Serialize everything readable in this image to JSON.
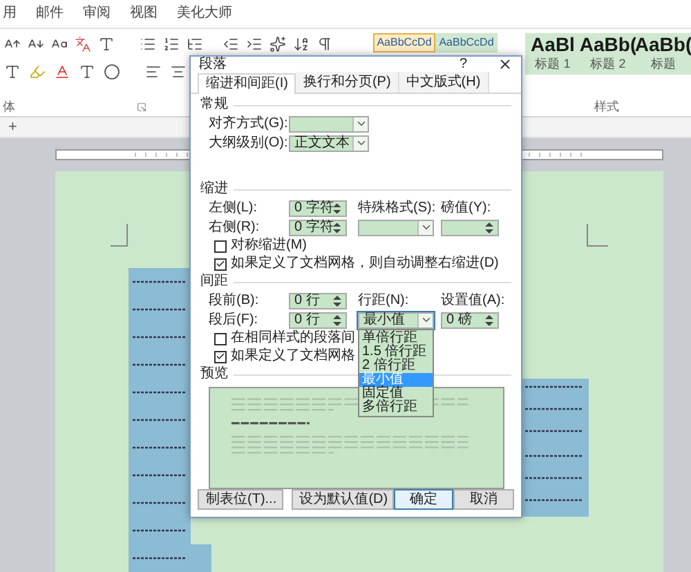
{
  "ribbon": {
    "tabs": [
      {
        "label": "用",
        "selected": false
      },
      {
        "label": "邮件",
        "selected": false
      },
      {
        "label": "审阅",
        "selected": false
      },
      {
        "label": "视图",
        "selected": false
      },
      {
        "label": "美化大师",
        "selected": false
      }
    ],
    "font_group_label": "体",
    "styles_group_label": "样式",
    "styles": [
      {
        "preview": "AaBbCcDd",
        "selected": true,
        "kind": "body"
      },
      {
        "preview": "AaBbCcDd",
        "selected": false,
        "kind": "body"
      },
      {
        "preview": "AaBl",
        "name": "标题 1",
        "selected": false,
        "kind": "heading"
      },
      {
        "preview": "AaBb(",
        "name": "标题 2",
        "selected": false,
        "kind": "heading"
      },
      {
        "preview": "AaBb(",
        "name": "标题",
        "selected": false,
        "kind": "heading"
      }
    ]
  },
  "document_tabs": {
    "add_label": "+"
  },
  "dialog": {
    "title": "段落",
    "help": "?",
    "tabs": [
      {
        "label": "缩进和间距(I)",
        "selected": true
      },
      {
        "label": "换行和分页(P)",
        "selected": false
      },
      {
        "label": "中文版式(H)",
        "selected": false
      }
    ],
    "general": {
      "heading": "常规",
      "alignment": {
        "label": "对齐方式(G):"
      },
      "outline_level": {
        "label": "大纲级别(O):",
        "value": "正文文本"
      }
    },
    "indent": {
      "heading": "缩进",
      "left": {
        "label": "左侧(L):",
        "value": "0 字符"
      },
      "right": {
        "label": "右侧(R):",
        "value": "0 字符"
      },
      "special": {
        "label": "特殊格式(S):"
      },
      "by": {
        "label": "磅值(Y):"
      },
      "checkboxes": [
        {
          "label": "对称缩进(M)",
          "checked": false
        },
        {
          "label": "如果定义了文档网格，则自动调整右缩进(D)",
          "checked": true
        }
      ]
    },
    "spacing": {
      "heading": "间距",
      "before": {
        "label": "段前(B):",
        "value": "0 行"
      },
      "after": {
        "label": "段后(F):",
        "value": "0 行"
      },
      "line_spacing": {
        "label": "行距(N):",
        "value": "最小值",
        "expanded": true,
        "options": [
          {
            "label": "单倍行距",
            "selected": false
          },
          {
            "label": "1.5 倍行距",
            "selected": false
          },
          {
            "label": "2 倍行距",
            "selected": false
          },
          {
            "label": "最小值",
            "selected": true
          },
          {
            "label": "固定值",
            "selected": false
          },
          {
            "label": "多倍行距",
            "selected": false
          }
        ]
      },
      "at": {
        "label": "设置值(A):",
        "value": "0 磅"
      },
      "checkboxes": [
        {
          "label": "在相同样式的段落间",
          "checked": false
        },
        {
          "label": "如果定义了文档网格",
          "checked": true
        }
      ]
    },
    "preview": {
      "heading": "预览"
    },
    "buttons": [
      {
        "label": "制表位(T)...",
        "default": false
      },
      {
        "label": "设为默认值(D)",
        "default": false
      },
      {
        "label": "确定",
        "default": true
      },
      {
        "label": "取消",
        "default": false
      }
    ]
  }
}
